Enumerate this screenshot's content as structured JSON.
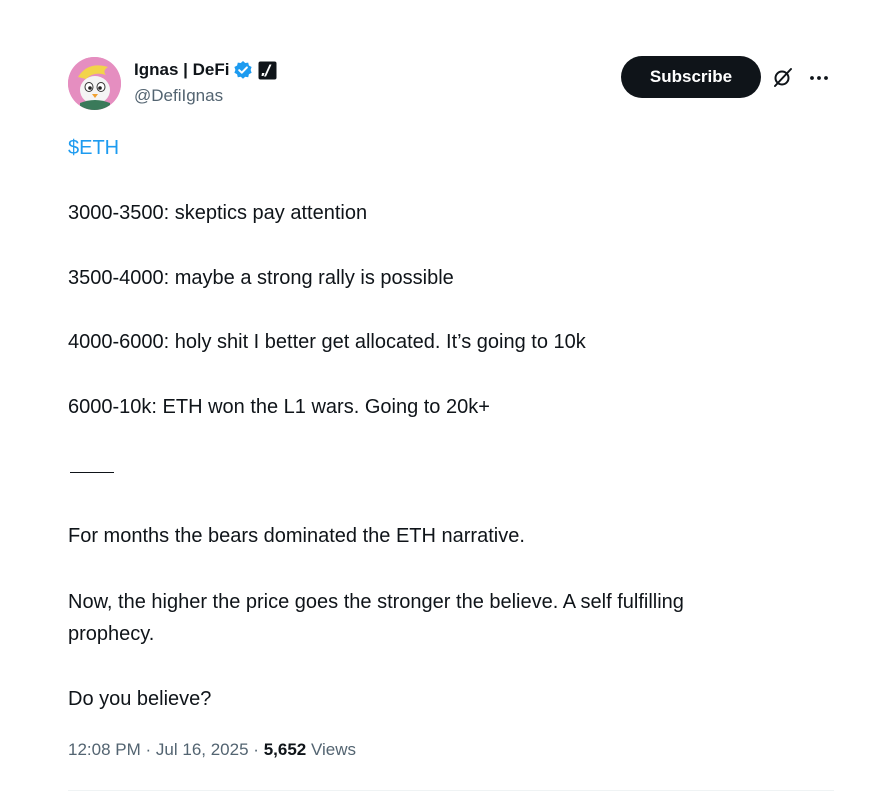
{
  "author": {
    "display_name": "Ignas | DeFi",
    "handle": "@DefiIgnas",
    "avatar_icon": "cartoon-bird-avatar",
    "verified_icon": "blue-verified-badge",
    "affiliate_icon": "affiliate-badge"
  },
  "actions": {
    "subscribe_label": "Subscribe",
    "grok_icon": "grok-icon",
    "more_icon": "more-options-icon"
  },
  "post": {
    "cashtag": "$ETH",
    "lines": [
      "3000-3500: skeptics pay attention",
      "3500-4000: maybe a strong rally is possible",
      "4000-6000: holy shit I better get allocated. It’s going to 10k",
      "6000-10k: ETH won the L1 wars. Going to 20k+",
      "For months the bears dominated the ETH narrative.",
      "Now, the higher the price goes the stronger the believe. A self fulfilling",
      "prophecy.",
      "Do you believe?"
    ]
  },
  "meta": {
    "time": "12:08 PM",
    "separator": "·",
    "date": "Jul 16, 2025",
    "views_count": "5,652",
    "views_label": "Views"
  },
  "colors": {
    "link": "#1d9bf0",
    "text": "#0f1419",
    "secondary": "#536471",
    "button_bg": "#0f1419"
  }
}
